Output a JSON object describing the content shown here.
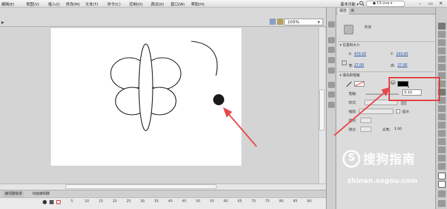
{
  "menubar": {
    "items": [
      "编辑(E)",
      "视图(V)",
      "插入(I)",
      "修改(M)",
      "文本(T)",
      "命令(C)",
      "控制(O)",
      "调试(D)",
      "窗口(W)",
      "帮助(H)"
    ],
    "workspace_label": "基本功能",
    "search_label": "CS Live"
  },
  "stage_header": {
    "zoom_value": "100%"
  },
  "timeline": {
    "tabs": [
      "编译器错误",
      "动画编辑器"
    ],
    "ruler_ticks": [
      "5",
      "10",
      "15",
      "20",
      "25",
      "30",
      "35",
      "40",
      "45",
      "50",
      "55",
      "60",
      "65",
      "70",
      "75",
      "80",
      "85",
      "90"
    ]
  },
  "panel": {
    "tabs": [
      "属性",
      "库"
    ],
    "object_label": "形状",
    "position_section": "位置和大小",
    "x_label": "X:",
    "x_value": "470.05",
    "y_label": "Y:",
    "y_value": "193.85",
    "w_label": "宽:",
    "w_value": "27.00",
    "h_label": "高:",
    "h_value": "27.00",
    "fill_section": "填充和笔触",
    "stroke_label": "笔触:",
    "stroke_value": "0.10",
    "style_label": "样式:",
    "scale_label": "缩放:",
    "hint_label": "提示",
    "cap_label": "端点:",
    "join_label": "接合:",
    "miter_label": "尖角:",
    "miter_value": "3.00",
    "fill_color": "#000000"
  },
  "watermark": {
    "text": "搜狗指南",
    "url": "zhinan.sogou.com"
  },
  "colors": {
    "highlight": "#e23a3a",
    "arrow": "#e8484a"
  }
}
